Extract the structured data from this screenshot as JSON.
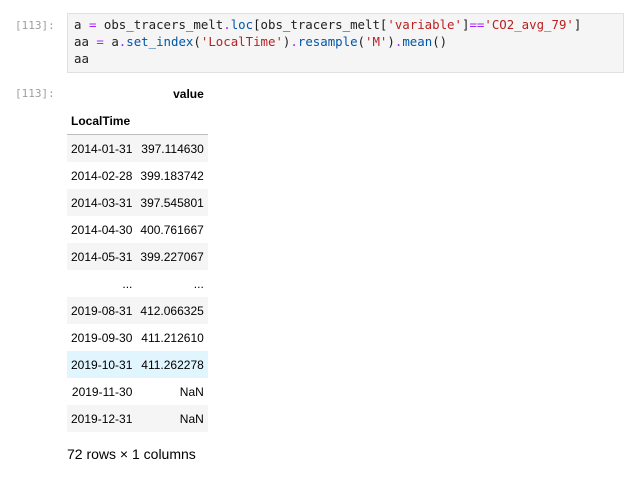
{
  "cells": {
    "input_prompt": "[113]:",
    "output_prompt": "[113]:"
  },
  "code": {
    "line1": [
      "a",
      " ",
      "=",
      " obs_tracers_melt",
      ".",
      "loc",
      "[obs_tracers_melt[",
      "'variable'",
      "]",
      "==",
      "'CO2_avg_79'",
      "]"
    ],
    "line2": [
      "aa",
      " ",
      "=",
      " a",
      ".",
      "set_index",
      "(",
      "'LocalTime'",
      ")",
      ".",
      "resample",
      "(",
      "'M'",
      ")",
      ".",
      "mean",
      "()"
    ],
    "line3": "aa"
  },
  "table": {
    "column_header": "value",
    "index_header": "LocalTime",
    "rows": [
      {
        "index": "2014-01-31",
        "value": "397.114630"
      },
      {
        "index": "2014-02-28",
        "value": "399.183742"
      },
      {
        "index": "2014-03-31",
        "value": "397.545801"
      },
      {
        "index": "2014-04-30",
        "value": "400.761667"
      },
      {
        "index": "2014-05-31",
        "value": "399.227067"
      },
      {
        "index": "...",
        "value": "..."
      },
      {
        "index": "2019-08-31",
        "value": "412.066325"
      },
      {
        "index": "2019-09-30",
        "value": "411.212610"
      },
      {
        "index": "2019-10-31",
        "value": "411.262278"
      },
      {
        "index": "2019-11-30",
        "value": "NaN"
      },
      {
        "index": "2019-12-31",
        "value": "NaN"
      }
    ]
  },
  "summary": "72 rows × 1 columns"
}
